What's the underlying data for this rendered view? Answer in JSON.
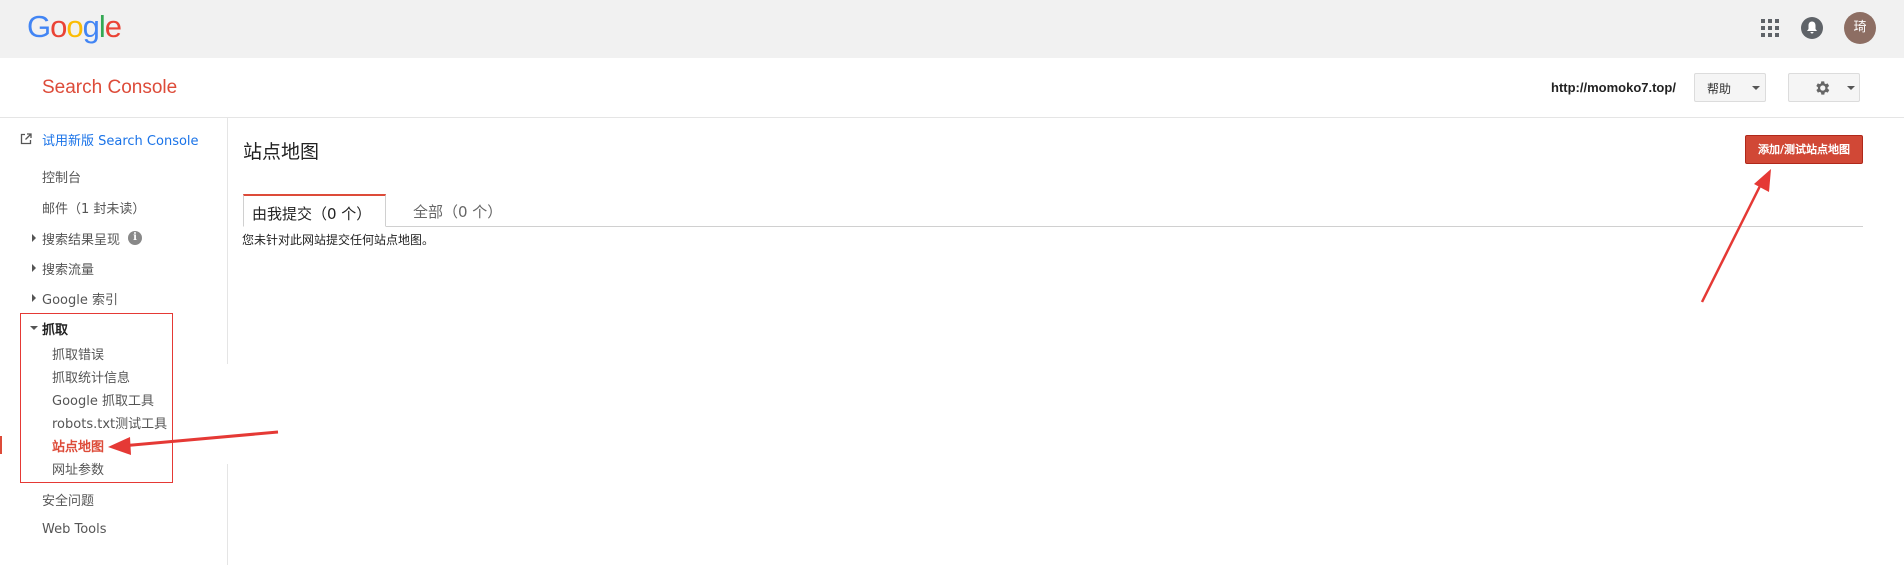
{
  "topbar": {
    "logo_letters": [
      {
        "ch": "G",
        "color": "#4285f4"
      },
      {
        "ch": "o",
        "color": "#ea4335"
      },
      {
        "ch": "o",
        "color": "#fbbc05"
      },
      {
        "ch": "g",
        "color": "#4285f4"
      },
      {
        "ch": "l",
        "color": "#34a853"
      },
      {
        "ch": "e",
        "color": "#ea4335"
      }
    ],
    "apps_icon": "apps-grid-icon",
    "notifications_icon": "bell-icon",
    "avatar_text": "琦"
  },
  "header": {
    "brand": "Search Console",
    "site_url": "http://momoko7.top/",
    "help_label": "帮助",
    "settings_icon": "gear-icon"
  },
  "sidebar": {
    "try_new": "试用新版 Search Console",
    "items": {
      "dashboard": "控制台",
      "messages": "邮件（1 封未读）",
      "search_appearance": "搜索结果呈现",
      "search_traffic": "搜索流量",
      "google_index": "Google 索引",
      "crawl": "抓取",
      "crawl_errors": "抓取错误",
      "crawl_stats": "抓取统计信息",
      "fetch_as_google": "Google 抓取工具",
      "robots_tester": "robots.txt测试工具",
      "sitemaps": "站点地图",
      "url_parameters": "网址参数",
      "security_issues": "安全问题",
      "web_tools": "Web Tools"
    }
  },
  "main": {
    "title": "站点地图",
    "add_button": "添加/测试站点地图",
    "tabs": {
      "submitted": "由我提交（0 个）",
      "all": "全部（0 个）"
    },
    "empty_message": "您未针对此网站提交任何站点地图。"
  },
  "colors": {
    "accent": "#dd4b39",
    "annotation": "#e53935",
    "link": "#1a73e8"
  }
}
